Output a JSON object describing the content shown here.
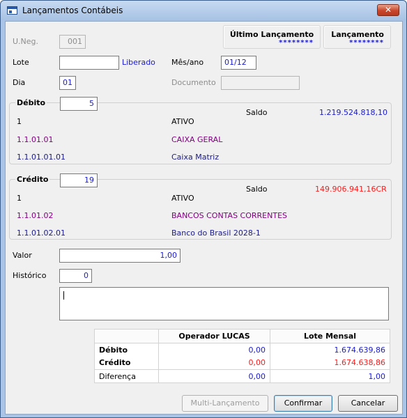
{
  "window": {
    "title": "Lançamentos Contábeis",
    "close": "✕"
  },
  "header": {
    "uneg_label": "U.Neg.",
    "uneg_value": "001",
    "ultimo_label": "Último Lançamento",
    "ultimo_value": "********",
    "lanc_label": "Lançamento",
    "lanc_value": "********"
  },
  "form": {
    "lote_label": "Lote",
    "lote_value": "",
    "lote_status": "Liberado",
    "mes_label": "Mês/ano",
    "mes_value": "01/12",
    "dia_label": "Dia",
    "dia_value": "01",
    "doc_label": "Documento",
    "doc_value": ""
  },
  "debito": {
    "legend": "Débito",
    "code": "5",
    "saldo_label": "Saldo",
    "saldo_value": "1.219.524.818,10",
    "rows": [
      {
        "code": "1",
        "name": "ATIVO"
      },
      {
        "code": "1.1.01.01",
        "name": "CAIXA GERAL"
      },
      {
        "code": "1.1.01.01.01",
        "name": "Caixa Matriz"
      }
    ]
  },
  "credito": {
    "legend": "Crédito",
    "code": "19",
    "saldo_label": "Saldo",
    "saldo_value": "149.906.941,16CR",
    "rows": [
      {
        "code": "1",
        "name": "ATIVO"
      },
      {
        "code": "1.1.01.02",
        "name": "BANCOS CONTAS CORRENTES"
      },
      {
        "code": "1.1.01.02.01",
        "name": "Banco do Brasil 2028-1"
      }
    ]
  },
  "valor": {
    "label": "Valor",
    "value": "1,00"
  },
  "historico": {
    "label": "Histórico",
    "code": "0",
    "text": ""
  },
  "summary": {
    "col1": "Operador LUCAS",
    "col2": "Lote Mensal",
    "debito_label": "Débito",
    "debito_op": "0,00",
    "debito_lote": "1.674.639,86",
    "credito_label": "Crédito",
    "credito_op": "0,00",
    "credito_lote": "1.674.638,86",
    "diff_label": "Diferença",
    "diff_op": "0,00",
    "diff_lote": "1,00"
  },
  "buttons": {
    "multi": "Multi-Lançamento",
    "confirm": "Confirmar",
    "cancel": "Cancelar"
  },
  "colors": {
    "blue": "#1a1ad0",
    "purple": "#800080",
    "red": "#ff1a1a"
  }
}
